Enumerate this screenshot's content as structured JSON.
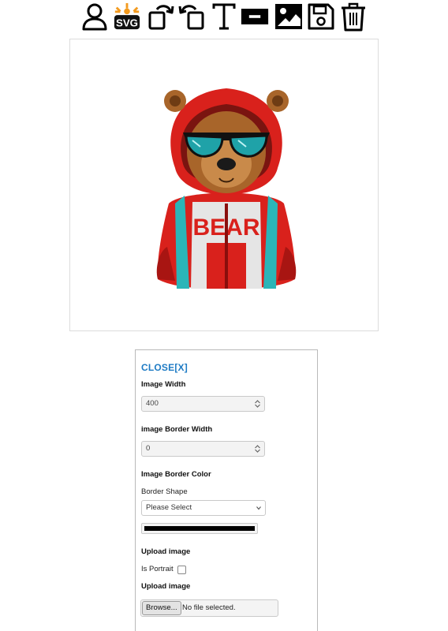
{
  "toolbar": {
    "tools": [
      {
        "icon": "user-icon"
      },
      {
        "icon": "svg-icon",
        "label": "SVG"
      },
      {
        "icon": "rotate-right-icon"
      },
      {
        "icon": "rotate-left-icon"
      },
      {
        "icon": "text-icon"
      },
      {
        "icon": "rectangle-icon"
      },
      {
        "icon": "image-icon"
      },
      {
        "icon": "save-icon"
      },
      {
        "icon": "trash-icon"
      }
    ]
  },
  "canvas": {
    "image_alt": "bear in red hoodie with sunglasses",
    "shirt_text": "BEAR"
  },
  "panel": {
    "close_label": "CLOSE[X]",
    "image_width_label": "Image Width",
    "image_width_value": "400",
    "border_width_label": "image Border Width",
    "border_width_value": "0",
    "border_color_label": "Image Border Color",
    "border_shape_label": "Border Shape",
    "border_shape_selected": "Please Select",
    "border_color_value": "#000000",
    "upload_label_1": "Upload image",
    "portrait_label": "Is Portrait",
    "upload_label_2": "Upload image",
    "browse_label": "Browse...",
    "file_status": "No file selected."
  },
  "colors": {
    "accent": "#1e7bc4",
    "hoodie": "#d9211c",
    "straps": "#2bb5b8",
    "fur": "#a8652a"
  }
}
